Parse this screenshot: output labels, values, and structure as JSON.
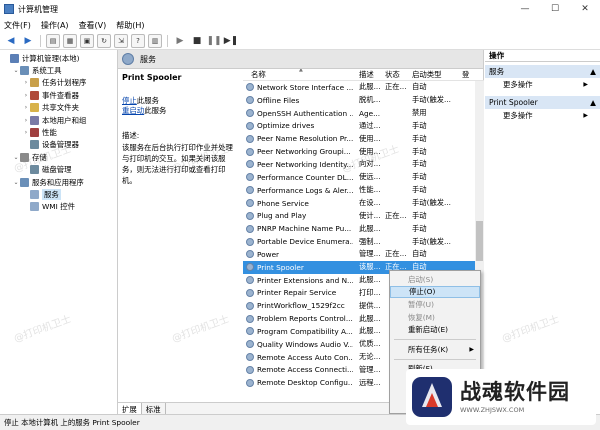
{
  "window": {
    "title": "计算机管理",
    "minimize": "—",
    "maximize": "☐",
    "close": "✕"
  },
  "menu": [
    "文件(F)",
    "操作(A)",
    "查看(V)",
    "帮助(H)"
  ],
  "tree": [
    {
      "label": "计算机管理(本地)",
      "arrow": "",
      "color": "#5b7fb6",
      "indent": 0
    },
    {
      "label": "系统工具",
      "arrow": "⌄",
      "color": "#6a8fb8",
      "indent": 1
    },
    {
      "label": "任务计划程序",
      "arrow": "›",
      "color": "#c9a04a",
      "indent": 2
    },
    {
      "label": "事件查看器",
      "arrow": "›",
      "color": "#b04a3a",
      "indent": 2
    },
    {
      "label": "共享文件夹",
      "arrow": "›",
      "color": "#d8b24a",
      "indent": 2
    },
    {
      "label": "本地用户和组",
      "arrow": "›",
      "color": "#7a7aa6",
      "indent": 2
    },
    {
      "label": "性能",
      "arrow": "›",
      "color": "#a04040",
      "indent": 2
    },
    {
      "label": "设备管理器",
      "arrow": "",
      "color": "#6c8a9e",
      "indent": 2
    },
    {
      "label": "存储",
      "arrow": "⌄",
      "color": "#8a8a8a",
      "indent": 1
    },
    {
      "label": "磁盘管理",
      "arrow": "",
      "color": "#6c8a9e",
      "indent": 2
    },
    {
      "label": "服务和应用程序",
      "arrow": "⌄",
      "color": "#6a8fb8",
      "indent": 1
    },
    {
      "label": "服务",
      "arrow": "",
      "color": "#8fa9c9",
      "indent": 2,
      "selected": true
    },
    {
      "label": "WMI 控件",
      "arrow": "",
      "color": "#8fa9c9",
      "indent": 2
    }
  ],
  "middle": {
    "header": "服务",
    "desc_title": "Print Spooler",
    "stop_link": "停止",
    "stop_suffix": "此服务",
    "restart_link": "重启动",
    "restart_suffix": "此服务",
    "desc_label": "描述:",
    "desc_text": "该服务在后台执行打印作业并处理与打印机的交互。如果关闭该服务，则无法进行打印或查看打印机。",
    "columns": {
      "name": "名称",
      "desc": "描述",
      "status": "状态",
      "start": "启动类型",
      "more": "登"
    },
    "services": [
      {
        "name": "Network Store Interface ...",
        "desc": "此服...",
        "status": "正在...",
        "start": "自动"
      },
      {
        "name": "Offline Files",
        "desc": "脱机...",
        "status": "",
        "start": "手动(触发..."
      },
      {
        "name": "OpenSSH Authentication ...",
        "desc": "Age...",
        "status": "",
        "start": "禁用"
      },
      {
        "name": "Optimize drives",
        "desc": "通过...",
        "status": "",
        "start": "手动"
      },
      {
        "name": "Peer Name Resolution Pr...",
        "desc": "使用...",
        "status": "",
        "start": "手动"
      },
      {
        "name": "Peer Networking Groupi...",
        "desc": "使用...",
        "status": "",
        "start": "手动"
      },
      {
        "name": "Peer Networking Identity...",
        "desc": "向对...",
        "status": "",
        "start": "手动"
      },
      {
        "name": "Performance Counter DL...",
        "desc": "使远...",
        "status": "",
        "start": "手动"
      },
      {
        "name": "Performance Logs & Aler...",
        "desc": "性能...",
        "status": "",
        "start": "手动"
      },
      {
        "name": "Phone Service",
        "desc": "在设...",
        "status": "",
        "start": "手动(触发..."
      },
      {
        "name": "Plug and Play",
        "desc": "使计...",
        "status": "正在...",
        "start": "手动"
      },
      {
        "name": "PNRP Machine Name Pu...",
        "desc": "此服...",
        "status": "",
        "start": "手动"
      },
      {
        "name": "Portable Device Enumera...",
        "desc": "强制...",
        "status": "",
        "start": "手动(触发..."
      },
      {
        "name": "Power",
        "desc": "管理...",
        "status": "正在...",
        "start": "自动"
      },
      {
        "name": "Print Spooler",
        "desc": "该服...",
        "status": "正在...",
        "start": "自动",
        "selected": true
      },
      {
        "name": "Printer Extensions and N...",
        "desc": "此服...",
        "status": "",
        "start": ""
      },
      {
        "name": "Printer Repair Service",
        "desc": "打印...",
        "status": "",
        "start": ""
      },
      {
        "name": "PrintWorkflow_1529f2cc",
        "desc": "提供...",
        "status": "",
        "start": ""
      },
      {
        "name": "Problem Reports Control...",
        "desc": "此服...",
        "status": "",
        "start": ""
      },
      {
        "name": "Program Compatibility A...",
        "desc": "此服...",
        "status": "",
        "start": ""
      },
      {
        "name": "Quality Windows Audio V...",
        "desc": "优质...",
        "status": "",
        "start": ""
      },
      {
        "name": "Remote Access Auto Con...",
        "desc": "无论...",
        "status": "",
        "start": ""
      },
      {
        "name": "Remote Access Connecti...",
        "desc": "管理...",
        "status": "",
        "start": ""
      },
      {
        "name": "Remote Desktop Configu...",
        "desc": "远程...",
        "status": "",
        "start": ""
      }
    ],
    "tabs": [
      "扩展",
      "标准"
    ]
  },
  "actions": {
    "header": "操作",
    "group1": "服务",
    "more1": "更多操作",
    "group2": "Print Spooler",
    "more2": "更多操作"
  },
  "context_menu": [
    {
      "label": "启动(S)",
      "disabled": true
    },
    {
      "label": "停止(O)",
      "highlight": true
    },
    {
      "label": "暂停(U)",
      "disabled": true
    },
    {
      "label": "恢复(M)",
      "disabled": true
    },
    {
      "label": "重新启动(E)"
    },
    {
      "sep": true
    },
    {
      "label": "所有任务(K)",
      "submenu": true
    },
    {
      "sep": true
    },
    {
      "label": "刷新(F)"
    }
  ],
  "status_text": "停止 本地计算机 上的服务 Print Spooler",
  "watermark": "@打印机卫士",
  "logo": {
    "name": "战魂软件园",
    "url": "WWW.ZHJSWX.COM"
  }
}
